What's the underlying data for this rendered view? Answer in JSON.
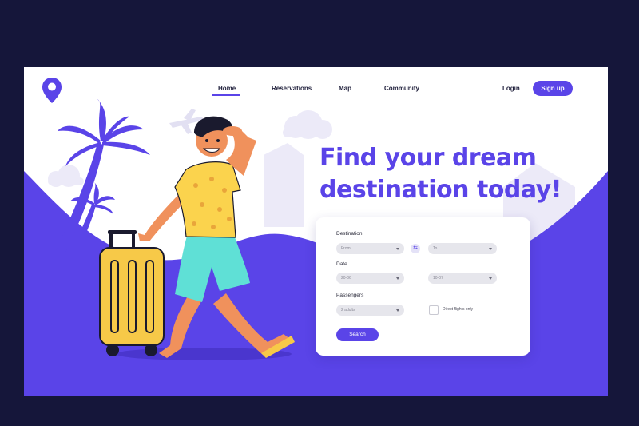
{
  "nav": {
    "items": [
      {
        "label": "Home",
        "active": true
      },
      {
        "label": "Reservations",
        "active": false
      },
      {
        "label": "Map",
        "active": false
      },
      {
        "label": "Community",
        "active": false
      }
    ],
    "login_label": "Login",
    "signup_label": "Sign up"
  },
  "hero": {
    "line1": "Find your dream",
    "line2": "destination today!"
  },
  "search_form": {
    "destination_label": "Destination",
    "from_placeholder": "From...",
    "to_placeholder": "To...",
    "date_label": "Date",
    "date_from": "20-06",
    "date_to": "10-07",
    "passengers_label": "Passengers",
    "passengers_value": "2 adults",
    "direct_flights_label": "Direct flights only",
    "direct_flights_checked": false,
    "search_label": "Search"
  },
  "icons": {
    "logo": "map-pin-icon",
    "swap": "swap-arrows-icon",
    "dropdown": "chevron-down-icon"
  },
  "colors": {
    "accent": "#5a44e8",
    "outer_background": "#15163a",
    "luggage": "#f7c948",
    "shirt": "#fbd34d",
    "shorts": "#5fe0d6",
    "skin": "#f0915c",
    "hair": "#1a1a2e"
  }
}
